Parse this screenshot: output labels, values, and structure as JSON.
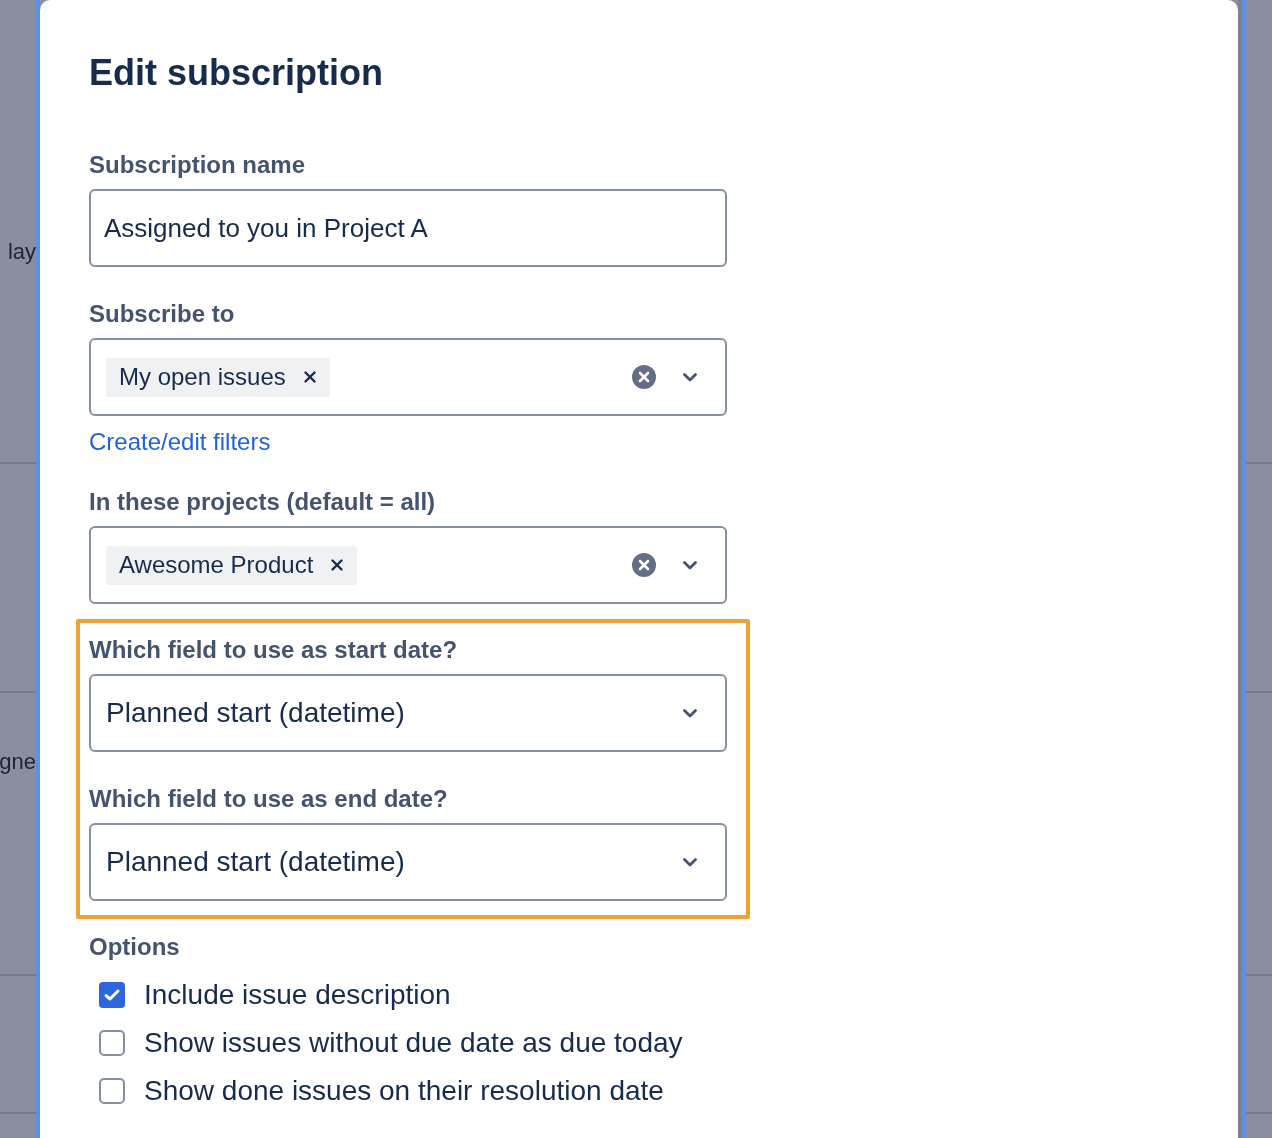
{
  "background": {
    "texts": [
      "lay",
      "gne"
    ]
  },
  "dialog": {
    "title": "Edit subscription",
    "fields": [
      {
        "kind": "text",
        "label": "Subscription name",
        "value": "Assigned to you in Project A",
        "highlighted": false
      },
      {
        "kind": "multiselect",
        "label": "Subscribe to",
        "chips": [
          "My open issues"
        ],
        "link": "Create/edit filters",
        "highlighted": false
      },
      {
        "kind": "multiselect",
        "label": "In these projects (default = all)",
        "chips": [
          "Awesome Product"
        ],
        "highlighted": false
      },
      {
        "kind": "select",
        "label": "Which field to use as start date?",
        "value": "Planned start (datetime)",
        "highlighted": true
      },
      {
        "kind": "select",
        "label": "Which field to use as end date?",
        "value": "Planned start (datetime)",
        "highlighted": true
      }
    ],
    "options": {
      "label": "Options",
      "items": [
        {
          "label": "Include issue description",
          "checked": true
        },
        {
          "label": "Show issues without due date as due today",
          "checked": false
        },
        {
          "label": "Show done issues on their resolution date",
          "checked": false
        }
      ]
    }
  }
}
